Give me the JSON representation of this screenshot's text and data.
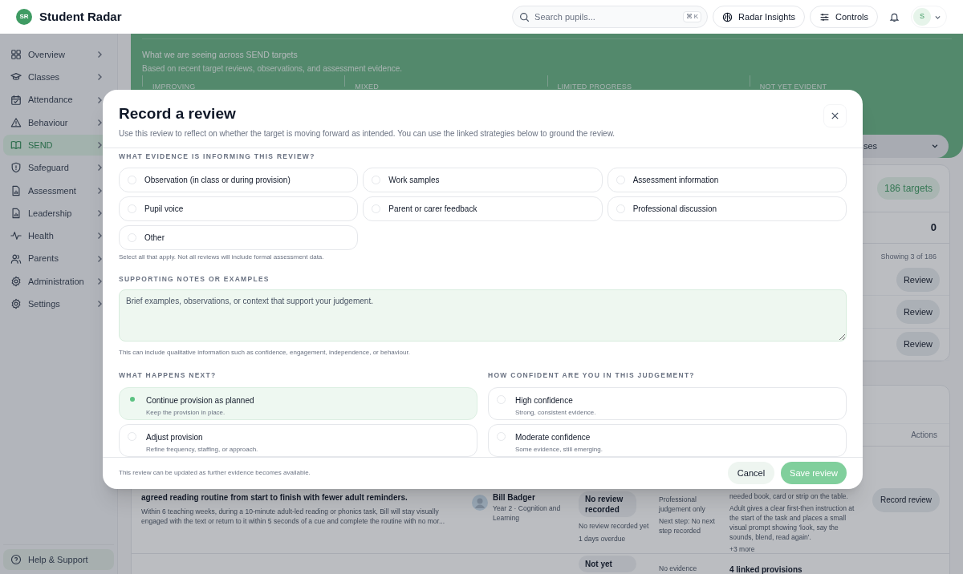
{
  "app": {
    "title": "Student Radar",
    "logo": "SR"
  },
  "topbar": {
    "search_placeholder": "Search pupils...",
    "shortcut": "⌘ K",
    "buttons": [
      "Radar Insights",
      "Controls"
    ],
    "avatar": "S"
  },
  "sidebar": {
    "items": [
      {
        "label": "Overview",
        "selected": false
      },
      {
        "label": "Classes",
        "selected": false
      },
      {
        "label": "Attendance",
        "selected": false
      },
      {
        "label": "Behaviour",
        "selected": false
      },
      {
        "label": "SEND",
        "selected": true
      },
      {
        "label": "Safeguard",
        "selected": false
      },
      {
        "label": "Assessment",
        "selected": false
      },
      {
        "label": "Leadership",
        "selected": false
      },
      {
        "label": "Health",
        "selected": false
      },
      {
        "label": "Parents",
        "selected": false
      },
      {
        "label": "Administration",
        "selected": false
      },
      {
        "label": "Settings",
        "selected": false
      }
    ],
    "help": "Help & Support"
  },
  "summary": {
    "title": "What we are seeing across SEND targets",
    "subtitle": "Based on recent target reviews, observations, and assessment evidence.",
    "categories": [
      "IMPROVING",
      "MIXED",
      "LIMITED PROGRESS",
      "NOT YET EVIDENT"
    ],
    "filter_value": "ses"
  },
  "targets_card": {
    "count": "186 targets",
    "stat": "0",
    "showing": "Showing 3 of 186",
    "review_buttons": [
      "Review",
      "Review",
      "Review"
    ]
  },
  "table": {
    "actions_header": "Actions",
    "rows": [
      {
        "title": "agreed reading routine from start to finish with fewer adult reminders.",
        "description": "Within 6 teaching weeks, during a 10-minute adult-led reading or phonics task, Bill will stay visually engaged with the text or return to it within 5 seconds of a cue and complete the routine with no mor...",
        "pupil": "Bill Badger",
        "pupil_detail": "Year 2 · Cognition and Learning",
        "status": "No review recorded",
        "status_note": "No review recorded yet",
        "overdue": "1 days overdue",
        "evidence": "Professional judgement only",
        "next_step": "Next step: No next step recorded",
        "provision_cut": "needed book, card or strip on the table.",
        "provision": "Adult gives a clear first-then instruction at the start of the task and places a small visual prompt showing 'look, say the sounds, blend, read again'.",
        "more": "+3 more",
        "action": "Record review"
      },
      {
        "status": "Not yet",
        "evidence": "No evidence",
        "provision_title": "4 linked provisions"
      }
    ]
  },
  "modal": {
    "title": "Record a review",
    "subtitle": "Use this review to reflect on whether the target is moving forward as intended. You can use the linked strategies below to ground the review.",
    "evidence": {
      "label": "WHAT EVIDENCE IS INFORMING THIS REVIEW?",
      "options": [
        {
          "label": "Observation (in class or during provision)",
          "checked": false
        },
        {
          "label": "Work samples",
          "checked": false
        },
        {
          "label": "Assessment information",
          "checked": false
        },
        {
          "label": "Pupil voice",
          "checked": false
        },
        {
          "label": "Parent or carer feedback",
          "checked": false
        },
        {
          "label": "Professional discussion",
          "checked": false
        },
        {
          "label": "Other",
          "checked": false
        }
      ],
      "hint": "Select all that apply. Not all reviews will include formal assessment data."
    },
    "notes": {
      "label": "SUPPORTING NOTES OR EXAMPLES",
      "placeholder": "Brief examples, observations, or context that support your judgement.",
      "hint": "This can include qualitative information such as confidence, engagement, independence, or behaviour."
    },
    "next": {
      "label": "WHAT HAPPENS NEXT?",
      "options": [
        {
          "title": "Continue provision as planned",
          "detail": "Keep the provision in place.",
          "selected": true
        },
        {
          "title": "Adjust provision",
          "detail": "Refine frequency, staffing, or approach.",
          "selected": false
        }
      ]
    },
    "confidence": {
      "label": "HOW CONFIDENT ARE YOU IN THIS JUDGEMENT?",
      "options": [
        {
          "title": "High confidence",
          "detail": "Strong, consistent evidence.",
          "selected": false
        },
        {
          "title": "Moderate confidence",
          "detail": "Some evidence, still emerging.",
          "selected": false
        }
      ]
    },
    "footer_note": "This review can be updated as further evidence becomes available.",
    "cancel": "Cancel",
    "save": {
      "label": "Save review",
      "disabled": true
    }
  }
}
